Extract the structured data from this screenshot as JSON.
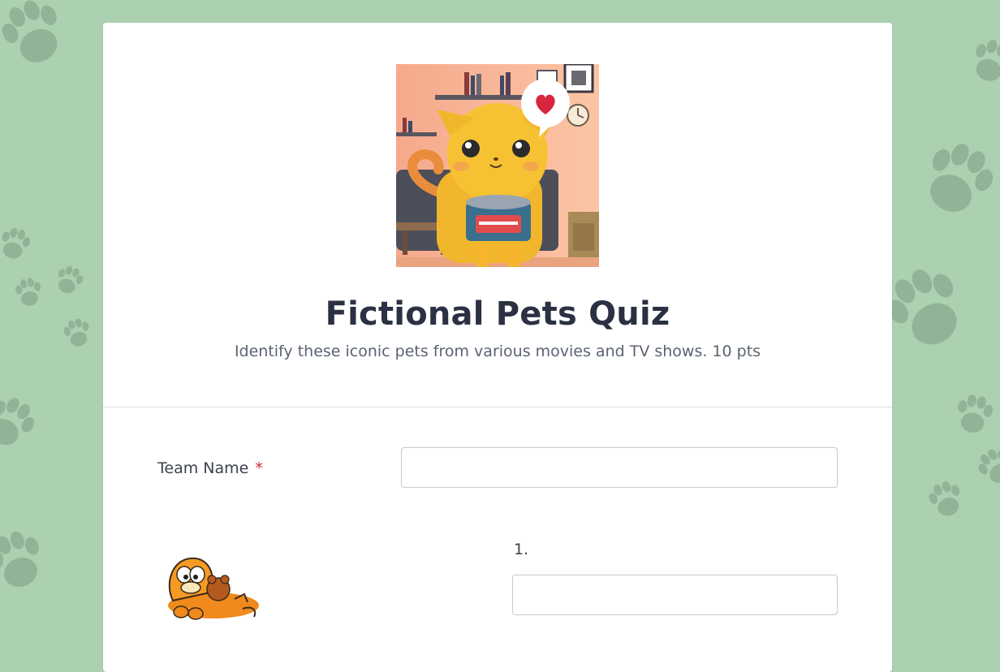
{
  "form": {
    "header_image": "cartoon-cat-holding-tuna-can-illustration",
    "title": "Fictional Pets Quiz",
    "description": "Identify these iconic pets from various movies and TV shows. 10 pts"
  },
  "fields": {
    "team_name": {
      "label": "Team Name",
      "required_mark": "*",
      "value": "",
      "placeholder": ""
    },
    "q1": {
      "number": "1.",
      "image": "garfield-and-pooky-cartoon",
      "value": "",
      "placeholder": ""
    }
  },
  "colors": {
    "background": "#abd1b0",
    "card": "#ffffff",
    "title": "#2b3142",
    "required": "#d22a2a",
    "paw": "#8fae92"
  },
  "icons": {
    "background_pattern": "paw-print-icon"
  }
}
